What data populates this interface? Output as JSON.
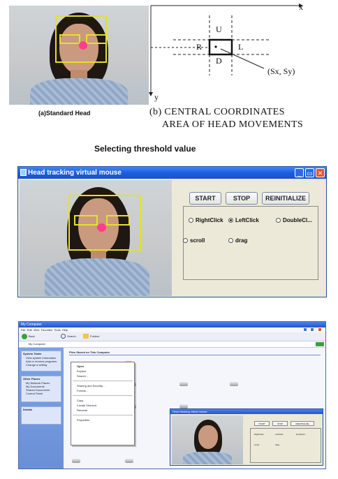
{
  "figure_top": {
    "caption_a": "(a)Standard Head",
    "caption_b_line1": "(b) CENTRAL COORDINATES",
    "caption_b_line2": "AREA OF HEAD MOVEMENTS",
    "axis_x": "x",
    "axis_y": "y",
    "region_up": "U",
    "region_down": "D",
    "region_right": "R",
    "region_left": "L",
    "center_label": "(Sx, Sy)",
    "threshold_caption": "Selecting threshold value"
  },
  "app_window": {
    "title": "Head tracking virtual mouse",
    "buttons": {
      "start": "START",
      "stop": "STOP",
      "reinitialize": "REINITIALIZE"
    },
    "options": [
      {
        "label": "RightClick",
        "selected": false
      },
      {
        "label": "LeftClick",
        "selected": true
      },
      {
        "label": "DoubleCl...",
        "selected": false
      },
      {
        "label": "scroll",
        "selected": false
      },
      {
        "label": "drag",
        "selected": false
      }
    ],
    "colors": {
      "title_bar": "#1b5ee0",
      "tracking_box": "#e6e028",
      "nose_marker": "#ff3f8a"
    }
  },
  "explorer": {
    "window_title": "My Computer",
    "menu_bar": [
      "File",
      "Edit",
      "View",
      "Favorites",
      "Tools",
      "Help"
    ],
    "toolbar": [
      "Back",
      "Search",
      "Folders"
    ],
    "address": "My Computer",
    "side_headers": [
      "System Tasks",
      "Other Places",
      "Details"
    ],
    "side_items": [
      "View system information",
      "Add or remove programs",
      "Change a setting",
      "My Network Places",
      "My Documents",
      "Shared Documents",
      "Control Panel"
    ],
    "content_header": "Files Stored on This Computer",
    "context_menu": [
      "Open",
      "Explore",
      "Search...",
      "Sharing and Security...",
      "Format...",
      "Copy",
      "Create Shortcut",
      "Rename",
      "Properties"
    ],
    "mini_window": {
      "title": "Head tracking virtual mouse",
      "buttons": [
        "START",
        "STOP",
        "REINITIALIZE"
      ],
      "options": [
        "RightClick",
        "LeftClick",
        "DoubleCl...",
        "scroll",
        "drag"
      ]
    }
  }
}
